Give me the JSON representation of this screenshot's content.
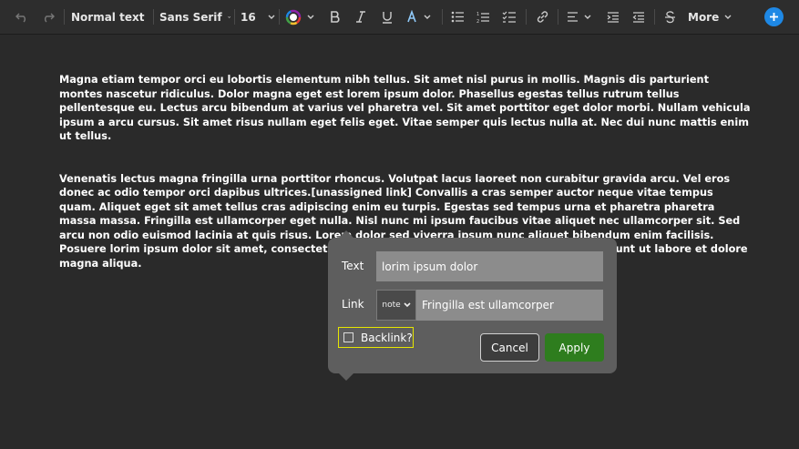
{
  "toolbar": {
    "block_style": "Normal text",
    "font_family": "Sans Serif",
    "font_size": "16",
    "more_label": "More",
    "colors": {
      "add_button": "#1e88e5"
    }
  },
  "document": {
    "paragraphs": [
      "Magna etiam tempor orci eu lobortis elementum nibh tellus. Sit amet  nisl purus in mollis. Magnis dis parturient montes nascetur ridiculus.  Dolor magna eget est lorem ipsum dolor. Phasellus egestas tellus rutrum  tellus pellentesque eu. Lectus arcu bibendum at varius vel pharetra vel.  Sit amet porttitor eget dolor morbi. Nullam vehicula ipsum a arcu  cursus. Sit amet risus nullam eget felis eget. Vitae semper quis lectus  nulla at. Nec dui nunc mattis enim ut tellus.",
      "Venenatis lectus magna fringilla urna porttitor rhoncus. Volutpat  lacus laoreet non curabitur gravida arcu. Vel eros donec ac odio tempor  orci dapibus ultrices.[unassigned link] Convallis a cras semper auctor neque vitae tempus  quam. Aliquet eget sit amet tellus cras adipiscing enim eu turpis.  Egestas sed tempus urna et pharetra pharetra massa massa. Fringilla est  ullamcorper eget nulla. Nisl nunc mi ipsum faucibus vitae aliquet nec  ullamcorper sit. Sed arcu non odio euismod lacinia at quis risus. Lorem  dolor sed viverra ipsum nunc aliquet bibendum enim facilisis. Posuere lorim ipsum dolor sit amet, consectetur adipisicing elit, sed do eiusmod tempor incididunt ut labore et dolore magna aliqua."
    ]
  },
  "link_popup": {
    "text_label": "Text",
    "text_value": "lorim ipsum dolor",
    "link_label": "Link",
    "link_type": "note",
    "link_value": "Fringilla est ullamcorper",
    "backlink_label": "Backlink?",
    "backlink_checked": false,
    "cancel_label": "Cancel",
    "apply_label": "Apply",
    "colors": {
      "apply": "#2e7d1e",
      "backlink_focus": "#e6e600"
    }
  }
}
